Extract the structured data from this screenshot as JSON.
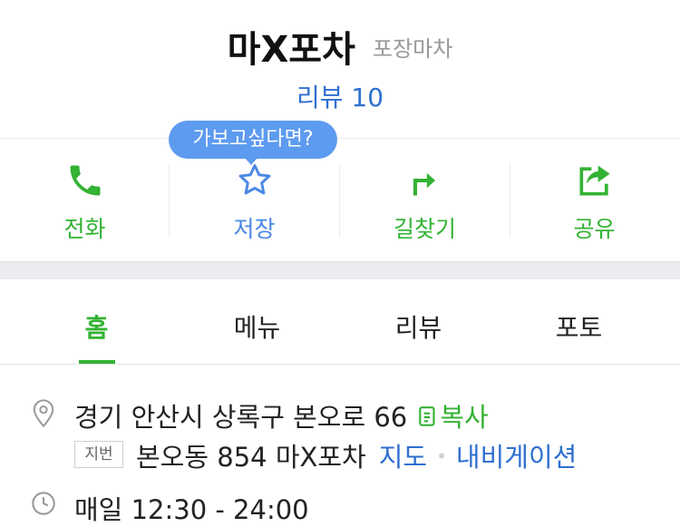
{
  "header": {
    "title": "마X포차",
    "category": "포장마차",
    "review_link": "리뷰 10"
  },
  "tooltip": {
    "text": "가보고싶다면?"
  },
  "actions": [
    {
      "label": "전화",
      "icon": "phone-icon"
    },
    {
      "label": "저장",
      "icon": "star-icon"
    },
    {
      "label": "길찾기",
      "icon": "directions-icon"
    },
    {
      "label": "공유",
      "icon": "share-icon"
    }
  ],
  "tabs": [
    {
      "label": "홈",
      "active": true
    },
    {
      "label": "메뉴",
      "active": false
    },
    {
      "label": "리뷰",
      "active": false
    },
    {
      "label": "포토",
      "active": false
    }
  ],
  "info": {
    "address": "경기 안산시 상록구 본오로 66",
    "copy_label": "복사",
    "jibun_tag": "지번",
    "jibun_address": "본오동 854 마X포차",
    "map_link": "지도",
    "separator": "•",
    "navigation_link": "내비게이션",
    "hours": "매일 12:30 - 24:00"
  },
  "colors": {
    "accent_green": "#33b233",
    "link_blue": "#2f6fd0",
    "tooltip_blue": "#5d9bf0"
  }
}
